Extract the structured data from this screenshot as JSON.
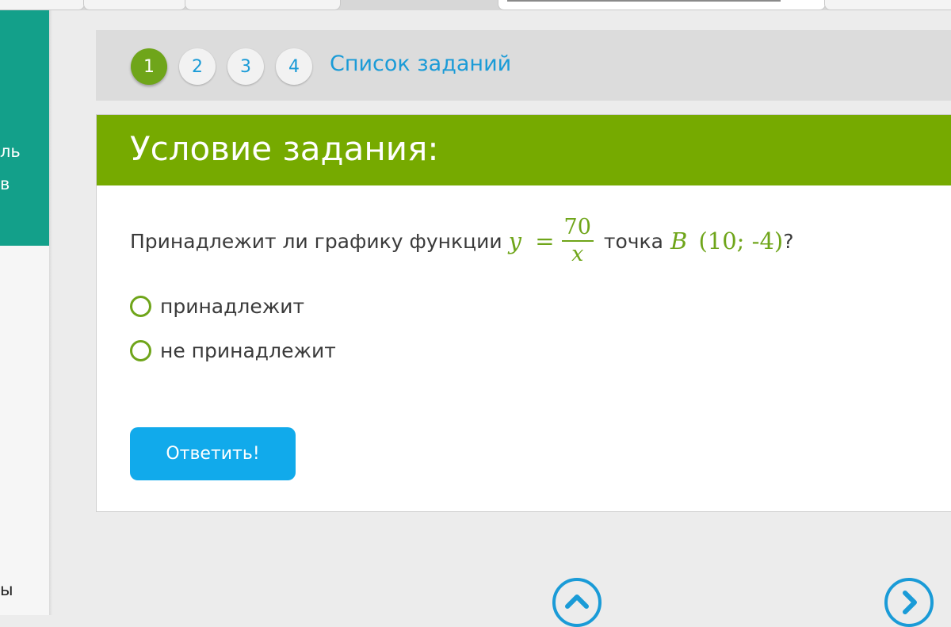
{
  "sidebar": {
    "text_line1": "ль",
    "text_line2": "в",
    "text_bottom": "ы"
  },
  "pager": {
    "items": [
      "1",
      "2",
      "3",
      "4"
    ],
    "active": "1",
    "task_list_label": "Список заданий"
  },
  "task": {
    "title": "Условие задания:",
    "question_prefix": "Принадлежит ли графику функции",
    "formula": {
      "lhs": "y",
      "eq": "=",
      "numerator": "70",
      "denominator": "x"
    },
    "question_middle": "точка",
    "point": "B",
    "point_coords": "(10; -4)",
    "question_suffix": "?",
    "options": [
      "принадлежит",
      "не принадлежит"
    ],
    "submit_label": "Ответить!"
  },
  "colors": {
    "accent_green": "#76aa00",
    "link_blue": "#1a9bd7",
    "button_blue": "#11aaeb",
    "sidebar_teal": "#13a08a"
  }
}
